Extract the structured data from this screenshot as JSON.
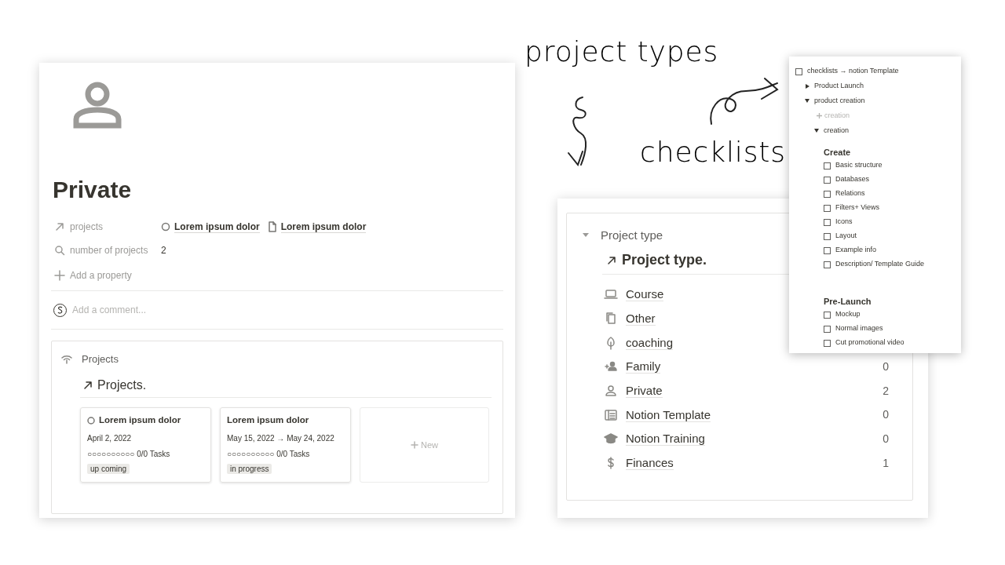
{
  "annotations": [
    {
      "text": "project types"
    },
    {
      "text": "checklists"
    }
  ],
  "private_page": {
    "title": "Private",
    "properties": [
      {
        "kind": "relation",
        "label": "projects",
        "values": [
          {
            "kind": "status",
            "text": "Lorem ipsum dolor"
          },
          {
            "kind": "page",
            "text": "Lorem ipsum dolor"
          }
        ]
      },
      {
        "kind": "number",
        "label": "number of projects",
        "value": "2"
      }
    ],
    "add_property": "Add a property",
    "comment_placeholder": "Add a comment...",
    "linked_view": {
      "label": "Projects",
      "title": "Projects.",
      "cards": [
        {
          "title": "Lorem ipsum dolor",
          "status_icon": true,
          "date": "April 2, 2022",
          "progress": "○○○○○○○○○○ 0/0 Tasks",
          "tag": "up coming"
        },
        {
          "title": "Lorem ipsum dolor",
          "status_icon": false,
          "date": "May 15, 2022 → May 24, 2022",
          "progress": "○○○○○○○○○○ 0/0 Tasks",
          "tag": "in progress"
        }
      ],
      "new_button": "New"
    }
  },
  "project_type_page": {
    "toggle": {
      "label": "Project type",
      "expanded": true
    },
    "title": "Project type.",
    "items": [
      {
        "kind": "laptop",
        "name": "Course"
      },
      {
        "kind": "copy",
        "name": "Other"
      },
      {
        "kind": "leaf",
        "name": "coaching"
      },
      {
        "kind": "family",
        "name": "Family",
        "count": "0"
      },
      {
        "kind": "person",
        "name": "Private",
        "count": "2"
      },
      {
        "kind": "table",
        "name": "Notion Template",
        "count": "0"
      },
      {
        "kind": "training",
        "name": "Notion Training",
        "count": "0"
      },
      {
        "kind": "money",
        "name": "Finances",
        "count": "1"
      }
    ]
  },
  "checklist_popup": {
    "root": {
      "kind": "todo",
      "text": "checklists → notion Template",
      "checked": false,
      "children": [
        {
          "kind": "toggle",
          "text": "Product Launch",
          "expanded": false
        },
        {
          "kind": "toggle",
          "text": "product creation",
          "expanded": true,
          "children": [
            {
              "kind": "add",
              "text": "creation"
            },
            {
              "kind": "toggle",
              "text": "creation",
              "expanded": true,
              "children": [
                {
                  "kind": "heading",
                  "text": "Create"
                },
                {
                  "kind": "todo",
                  "text": "Basic structure",
                  "checked": false
                },
                {
                  "kind": "todo",
                  "text": "Databases",
                  "checked": false
                },
                {
                  "kind": "todo",
                  "text": "Relations",
                  "checked": false
                },
                {
                  "kind": "todo",
                  "text": "Filters+ Views",
                  "checked": false
                },
                {
                  "kind": "todo",
                  "text": "Icons",
                  "checked": false
                },
                {
                  "kind": "todo",
                  "text": "Layout",
                  "checked": false
                },
                {
                  "kind": "todo",
                  "text": "Example info",
                  "checked": false
                },
                {
                  "kind": "todo",
                  "text": "Description/ Template Guide",
                  "checked": false
                },
                {
                  "kind": "heading",
                  "text": "Pre-Launch"
                },
                {
                  "kind": "todo",
                  "text": "Mockup",
                  "checked": false
                },
                {
                  "kind": "todo",
                  "text": "Normal images",
                  "checked": false
                },
                {
                  "kind": "todo",
                  "text": "Cut promotional video",
                  "checked": false
                }
              ]
            }
          ]
        }
      ]
    }
  }
}
